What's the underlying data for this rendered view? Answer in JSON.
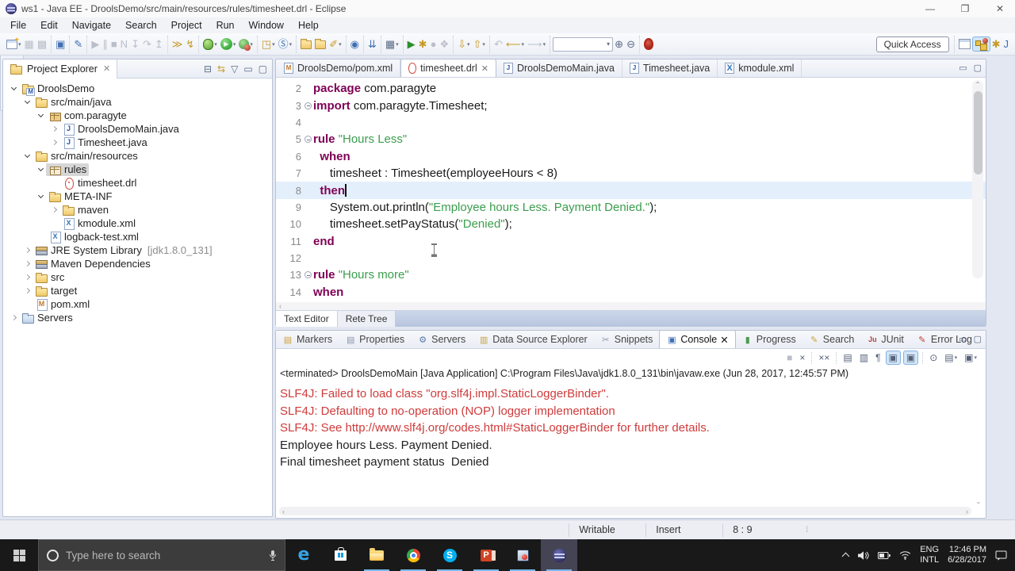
{
  "window": {
    "title": "ws1 - Java EE - DroolsDemo/src/main/resources/rules/timesheet.drl - Eclipse"
  },
  "menu_bar": {
    "items": [
      "File",
      "Edit",
      "Navigate",
      "Search",
      "Project",
      "Run",
      "Window",
      "Help"
    ]
  },
  "toolbar": {
    "quick_access_label": "Quick Access",
    "groups": [
      [
        {
          "name": "new-wizard",
          "kind": "new",
          "dd": true
        },
        {
          "name": "save",
          "glyph": "▦",
          "dis": true
        },
        {
          "name": "save-all",
          "glyph": "▩",
          "dis": true
        }
      ],
      [
        {
          "name": "console-view",
          "glyph": "▣",
          "cls": "blue"
        }
      ],
      [
        {
          "name": "open-type",
          "glyph": "✎",
          "cls": "blue"
        }
      ],
      [
        {
          "name": "resume",
          "glyph": "▶",
          "dis": true
        },
        {
          "name": "suspend",
          "glyph": "∥",
          "dis": true
        },
        {
          "name": "terminate",
          "glyph": "■",
          "dis": true
        },
        {
          "name": "step-filters",
          "glyph": "N",
          "dis": true
        },
        {
          "name": "step-into",
          "glyph": "↧",
          "dis": true
        },
        {
          "name": "step-over",
          "glyph": "↷",
          "dis": true
        },
        {
          "name": "step-return",
          "glyph": "↥",
          "dis": true
        }
      ],
      [
        {
          "name": "skip-breakpoints",
          "glyph": "≫",
          "cls": "gold"
        },
        {
          "name": "drools-validate",
          "glyph": "↯",
          "cls": "gold"
        }
      ],
      [
        {
          "name": "debug",
          "kind": "debug",
          "dd": true
        },
        {
          "name": "run",
          "kind": "run",
          "dd": true
        },
        {
          "name": "profile",
          "kind": "profile",
          "dd": true
        }
      ],
      [
        {
          "name": "new-web-project",
          "glyph": "◳",
          "cls": "gold",
          "dd": true
        },
        {
          "name": "new-servlet",
          "glyph": "Ⓢ",
          "cls": "blue",
          "dd": true
        }
      ],
      [
        {
          "name": "open-resource",
          "kind": "folder"
        },
        {
          "name": "open-file",
          "kind": "folder"
        },
        {
          "name": "annotate",
          "glyph": "✐",
          "cls": "gold",
          "dd": true
        }
      ],
      [
        {
          "name": "web-browser",
          "glyph": "◉",
          "cls": "blue"
        }
      ],
      [
        {
          "name": "import-wizard",
          "glyph": "⇊",
          "cls": "blue"
        }
      ],
      [
        {
          "name": "dataset-table",
          "glyph": "▦",
          "dd": true
        }
      ],
      [
        {
          "name": "start-server",
          "glyph": "▶",
          "cls": "green"
        },
        {
          "name": "debug-drools",
          "glyph": "✱",
          "cls": "gold"
        },
        {
          "name": "stop-server",
          "glyph": "●",
          "dis": true
        },
        {
          "name": "pause-server",
          "glyph": "❖",
          "dis": true
        }
      ],
      [
        {
          "name": "save-download",
          "glyph": "⇩",
          "cls": "gold",
          "dd": true
        },
        {
          "name": "upload",
          "glyph": "⇧",
          "cls": "gold",
          "dd": true
        }
      ],
      [
        {
          "name": "last-edit-location",
          "glyph": "↶",
          "dis": true
        },
        {
          "name": "back",
          "glyph": "⟵",
          "cls": "gold",
          "dd": true
        },
        {
          "name": "forward",
          "glyph": "⟶",
          "dis": true,
          "dd": true
        }
      ],
      [
        {
          "name": "text-zoom-combo",
          "kind": "combo"
        },
        {
          "name": "zoom-in",
          "glyph": "⊕"
        },
        {
          "name": "zoom-out",
          "glyph": "⊖"
        }
      ],
      [
        {
          "name": "drools-head",
          "kind": "drools"
        }
      ]
    ],
    "perspectives": [
      {
        "name": "open-perspective",
        "kind": "persp-new"
      },
      {
        "name": "java-ee-perspective",
        "kind": "persp-jee",
        "active": true
      },
      {
        "name": "debug-perspective",
        "glyph": "✱",
        "cls": "gold"
      },
      {
        "name": "java-perspective",
        "glyph": "J",
        "cls": "blue"
      }
    ]
  },
  "explorer": {
    "title": "Project Explorer",
    "tree": [
      {
        "depth": 0,
        "expand": "open",
        "icon": "maven-project",
        "label": "DroolsDemo"
      },
      {
        "depth": 1,
        "expand": "open",
        "icon": "src-folder",
        "label": "src/main/java"
      },
      {
        "depth": 2,
        "expand": "open",
        "icon": "package",
        "label": "com.paragyte"
      },
      {
        "depth": 3,
        "expand": "closed",
        "icon": "java-file",
        "label": "DroolsDemoMain.java"
      },
      {
        "depth": 3,
        "expand": "closed",
        "icon": "java-file",
        "label": "Timesheet.java"
      },
      {
        "depth": 1,
        "expand": "open",
        "icon": "src-folder",
        "label": "src/main/resources"
      },
      {
        "depth": 2,
        "expand": "open",
        "icon": "package-lite",
        "label": "rules",
        "selected": true
      },
      {
        "depth": 3,
        "expand": "none",
        "icon": "drools-file",
        "label": "timesheet.drl"
      },
      {
        "depth": 2,
        "expand": "open",
        "icon": "folder",
        "label": "META-INF"
      },
      {
        "depth": 3,
        "expand": "closed",
        "icon": "folder",
        "label": "maven"
      },
      {
        "depth": 3,
        "expand": "none",
        "icon": "xml-file",
        "label": "kmodule.xml"
      },
      {
        "depth": 2,
        "expand": "none",
        "icon": "xml-file",
        "label": "logback-test.xml"
      },
      {
        "depth": 1,
        "expand": "closed",
        "icon": "library",
        "label": "JRE System Library",
        "detail": "[jdk1.8.0_131]"
      },
      {
        "depth": 1,
        "expand": "closed",
        "icon": "library",
        "label": "Maven Dependencies"
      },
      {
        "depth": 1,
        "expand": "closed",
        "icon": "folder",
        "label": "src"
      },
      {
        "depth": 1,
        "expand": "closed",
        "icon": "folder",
        "label": "target"
      },
      {
        "depth": 1,
        "expand": "none",
        "icon": "pom-file",
        "label": "pom.xml"
      },
      {
        "depth": 0,
        "expand": "closed",
        "icon": "servers-folder",
        "label": "Servers"
      }
    ]
  },
  "editor": {
    "tabs": [
      {
        "label": "DroolsDemo/pom.xml",
        "icon": "m"
      },
      {
        "label": "timesheet.drl",
        "icon": "drl",
        "active": true,
        "closable": true
      },
      {
        "label": "DroolsDemoMain.java",
        "icon": "j"
      },
      {
        "label": "Timesheet.java",
        "icon": "j"
      },
      {
        "label": "kmodule.xml",
        "icon": "x"
      }
    ],
    "lines": [
      {
        "num": "2",
        "seg": [
          [
            "k",
            "package"
          ],
          [
            "p",
            " com.paragyte"
          ]
        ]
      },
      {
        "num": "3",
        "fold": true,
        "seg": [
          [
            "k",
            "import"
          ],
          [
            "p",
            " com.paragyte.Timesheet;"
          ]
        ]
      },
      {
        "num": "4",
        "seg": []
      },
      {
        "num": "5",
        "fold": true,
        "seg": [
          [
            "k",
            "rule"
          ],
          [
            "p",
            " "
          ],
          [
            "s",
            "\"Hours Less\""
          ]
        ]
      },
      {
        "num": "6",
        "seg": [
          [
            "p",
            "  "
          ],
          [
            "k",
            "when"
          ]
        ]
      },
      {
        "num": "7",
        "seg": [
          [
            "p",
            "     timesheet : Timesheet(employeeHours < 8)"
          ]
        ]
      },
      {
        "num": "8",
        "current": true,
        "cursor": true,
        "seg": [
          [
            "p",
            "  "
          ],
          [
            "k",
            "then"
          ]
        ]
      },
      {
        "num": "9",
        "seg": [
          [
            "p",
            "     System.out.println("
          ],
          [
            "s",
            "\"Employee hours Less. Payment Denied.\""
          ],
          [
            "p",
            ");"
          ]
        ]
      },
      {
        "num": "10",
        "seg": [
          [
            "p",
            "     timesheet.setPayStatus("
          ],
          [
            "s",
            "\"Denied\""
          ],
          [
            "p",
            ");"
          ]
        ]
      },
      {
        "num": "11",
        "seg": [
          [
            "k",
            "end"
          ]
        ]
      },
      {
        "num": "12",
        "seg": []
      },
      {
        "num": "13",
        "fold": true,
        "seg": [
          [
            "k",
            "rule"
          ],
          [
            "p",
            " "
          ],
          [
            "s",
            "\"Hours more\""
          ]
        ]
      },
      {
        "num": "14",
        "seg": [
          [
            "k",
            "when"
          ]
        ]
      }
    ],
    "bottom_tabs": [
      {
        "label": "Text Editor",
        "active": true
      },
      {
        "label": "Rete Tree"
      }
    ]
  },
  "console": {
    "tabs": [
      {
        "label": "Markers",
        "icon": "markers",
        "glyph": "▤"
      },
      {
        "label": "Properties",
        "icon": "properties",
        "glyph": "▤"
      },
      {
        "label": "Servers",
        "icon": "servers",
        "glyph": "⚙"
      },
      {
        "label": "Data Source Explorer",
        "icon": "datasource",
        "glyph": "▥"
      },
      {
        "label": "Snippets",
        "icon": "snippets",
        "glyph": "✂"
      },
      {
        "label": "Console",
        "icon": "console",
        "glyph": "▣",
        "active": true,
        "closable": true
      },
      {
        "label": "Progress",
        "icon": "progress",
        "glyph": "▮"
      },
      {
        "label": "Search",
        "icon": "search",
        "glyph": "✎"
      },
      {
        "label": "JUnit",
        "icon": "junit",
        "glyph": "Ju"
      },
      {
        "label": "Error Log",
        "icon": "errorlog",
        "glyph": "✎"
      }
    ],
    "toolbar": [
      {
        "name": "terminate",
        "glyph": "■",
        "dis": true
      },
      {
        "name": "remove-launch",
        "glyph": "×"
      },
      {
        "name": "remove-all-terminated",
        "glyph": "××",
        "sep": true
      },
      {
        "name": "clear-console",
        "glyph": "▤",
        "sep": true
      },
      {
        "name": "scroll-lock",
        "glyph": "▥"
      },
      {
        "name": "word-wrap",
        "glyph": "¶"
      },
      {
        "name": "show-on-stdout",
        "glyph": "▣",
        "active": true
      },
      {
        "name": "show-on-stderr",
        "glyph": "▣",
        "active": true
      },
      {
        "name": "pin-console",
        "glyph": "⊙",
        "sep": true
      },
      {
        "name": "display-selected-console",
        "glyph": "▤",
        "dd": true
      },
      {
        "name": "open-console",
        "glyph": "▣",
        "dd": true
      }
    ],
    "header": "<terminated> DroolsDemoMain [Java Application] C:\\Program Files\\Java\\jdk1.8.0_131\\bin\\javaw.exe (Jun 28, 2017, 12:45:57 PM)",
    "output": [
      {
        "level": "error",
        "text": "SLF4J: Failed to load class \"org.slf4j.impl.StaticLoggerBinder\"."
      },
      {
        "level": "error",
        "text": "SLF4J: Defaulting to no-operation (NOP) logger implementation"
      },
      {
        "level": "error",
        "text": "SLF4J: See http://www.slf4j.org/codes.html#StaticLoggerBinder for further details."
      },
      {
        "level": "normal",
        "text": "Employee hours Less. Payment Denied."
      },
      {
        "level": "normal",
        "text": "Final timesheet payment status  Denied"
      }
    ]
  },
  "status_bar": {
    "writable": "Writable",
    "insert_mode": "Insert",
    "caret_position": "8 : 9"
  },
  "taskbar": {
    "search_placeholder": "Type here to search",
    "apps": [
      {
        "name": "edge"
      },
      {
        "name": "store"
      },
      {
        "name": "file-explorer",
        "underline": true
      },
      {
        "name": "chrome",
        "underline": true
      },
      {
        "name": "skype",
        "underline": true
      },
      {
        "name": "powerpoint",
        "underline": true
      },
      {
        "name": "screen-recorder",
        "underline": true
      },
      {
        "name": "eclipse",
        "underline": true,
        "focused": true
      }
    ],
    "tray": {
      "lang_line1": "ENG",
      "lang_line2": "INTL",
      "time": "12:46 PM",
      "date": "6/28/2017"
    }
  }
}
